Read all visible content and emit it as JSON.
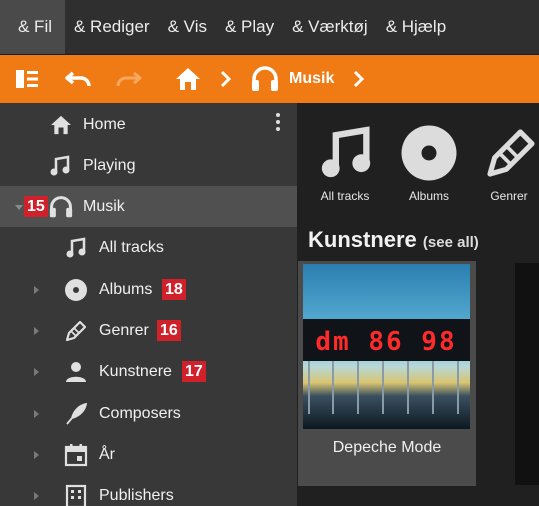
{
  "menu": {
    "items": [
      "& Fil",
      "& Rediger",
      "& Vis",
      "& Play",
      "& Værktøj",
      "& Hjælp"
    ]
  },
  "toolbar": {
    "icons": [
      "sidebar-toggle-icon",
      "undo-icon",
      "redo-icon",
      "home-icon",
      "chevron-right-icon",
      "headphones-icon",
      "chevron-right-icon"
    ],
    "breadcrumb_label": "Musik"
  },
  "sidebar": {
    "items": [
      {
        "label": "Home",
        "icon": "home-icon"
      },
      {
        "label": "Playing",
        "icon": "music-note-icon"
      },
      {
        "label": "Musik",
        "icon": "headphones-icon",
        "badge": "15",
        "selected": true
      },
      {
        "label": "All tracks",
        "icon": "music-note-icon"
      },
      {
        "label": "Albums",
        "icon": "disc-icon",
        "badge": "18"
      },
      {
        "label": "Genrer",
        "icon": "pencil-icon",
        "badge": "16"
      },
      {
        "label": "Kunstnere",
        "icon": "person-icon",
        "badge": "17"
      },
      {
        "label": "Composers",
        "icon": "quill-icon"
      },
      {
        "label": "År",
        "icon": "calendar-icon"
      },
      {
        "label": "Publishers",
        "icon": "building-icon"
      }
    ]
  },
  "main": {
    "categories": [
      {
        "label": "All tracks",
        "icon": "music-note-icon"
      },
      {
        "label": "Albums",
        "icon": "disc-icon"
      },
      {
        "label": "Genrer",
        "icon": "pencil-icon"
      }
    ],
    "section_title": "Kunstnere",
    "section_link": "(see all)",
    "artist": {
      "name": "Depeche Mode",
      "art_text": "dm 86 98"
    }
  },
  "colors": {
    "accent": "#f07a14",
    "badge": "#d0202a",
    "sidebar_bg": "#383838",
    "selected_bg": "#505050"
  }
}
